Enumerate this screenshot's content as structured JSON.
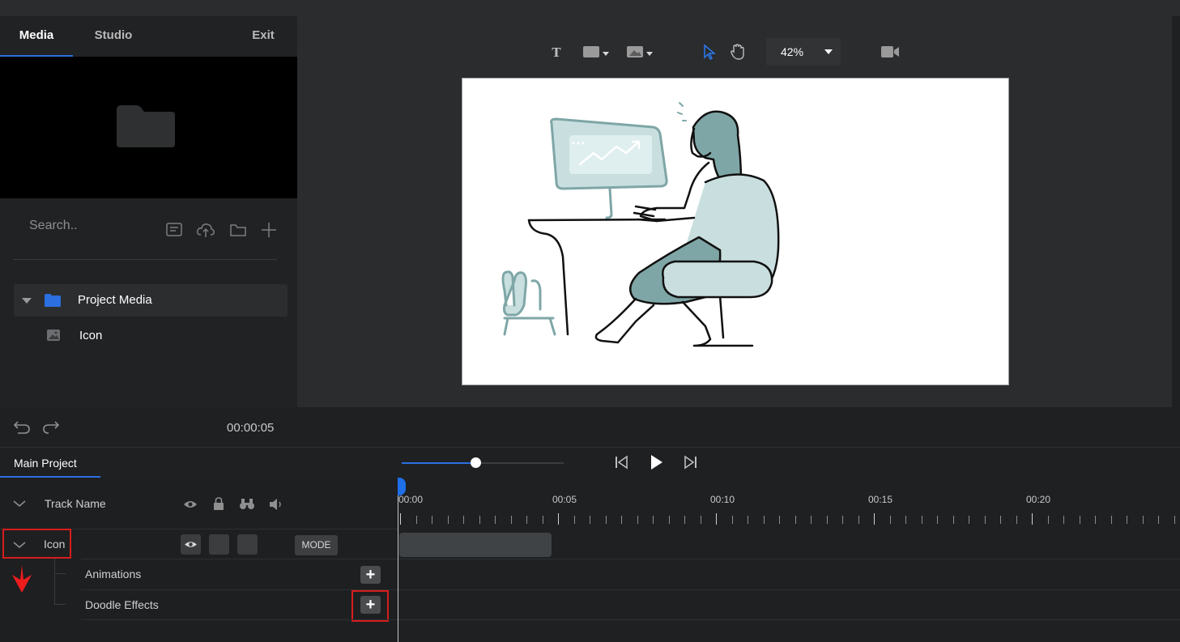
{
  "tabs": {
    "media": "Media",
    "studio": "Studio",
    "exit": "Exit"
  },
  "search": {
    "placeholder": "Search.."
  },
  "media_tree": {
    "folder_label": "Project Media",
    "item_label": "Icon"
  },
  "toolbar": {
    "zoom": "42%"
  },
  "transport": {
    "timecode": "00:00:05"
  },
  "timeline": {
    "tab_label": "Main Project",
    "ruler_labels": [
      "00:00",
      "00:05",
      "00:10",
      "00:15",
      "00:20"
    ],
    "header_row_label": "Track Name",
    "track_label": "Icon",
    "mode_label": "MODE",
    "sub_rows": [
      "Animations",
      "Doodle Effects"
    ]
  },
  "colors": {
    "accent": "#2b6fe0",
    "highlight": "#d71d1d",
    "illustration": "#7fa6a6"
  }
}
